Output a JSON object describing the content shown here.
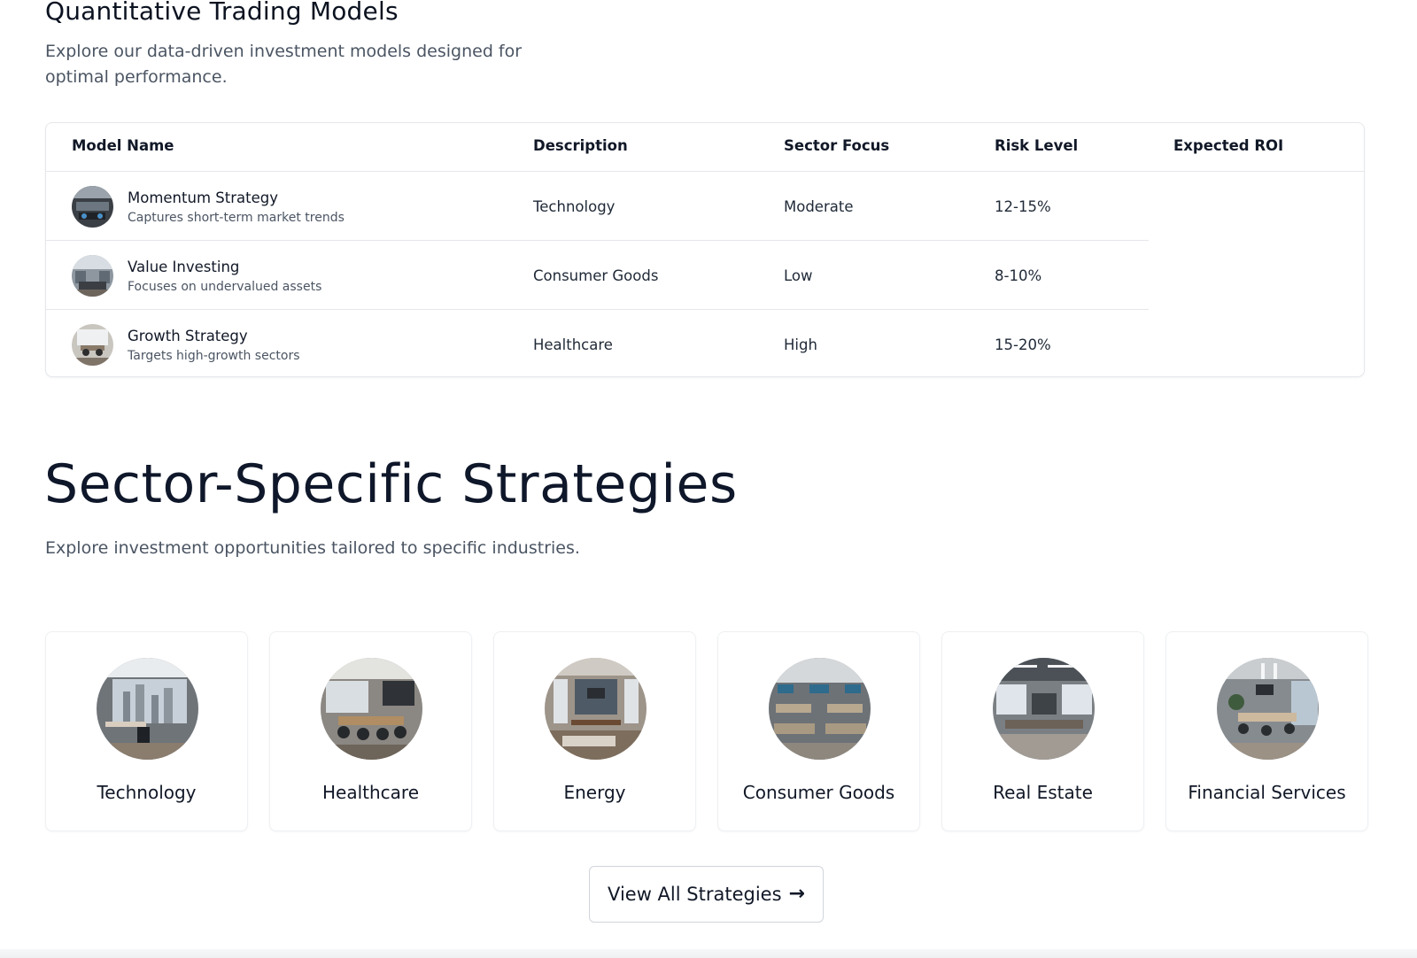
{
  "quant": {
    "title": "Quantitative Trading Models",
    "subtitle": "Explore our data-driven investment models designed for optimal performance.",
    "columns": [
      "Model Name",
      "Description",
      "Sector Focus",
      "Risk Level",
      "Expected ROI"
    ],
    "rows": [
      {
        "name": "Momentum Strategy",
        "desc": "Captures short-term market trends",
        "c1": "Technology",
        "c2": "Moderate",
        "c3": "12-15%"
      },
      {
        "name": "Value Investing",
        "desc": "Focuses on undervalued assets",
        "c1": "Consumer Goods",
        "c2": "Low",
        "c3": "8-10%"
      },
      {
        "name": "Growth Strategy",
        "desc": "Targets high-growth sectors",
        "c1": "Healthcare",
        "c2": "High",
        "c3": "15-20%"
      }
    ]
  },
  "sectors": {
    "title": "Sector-Specific Strategies",
    "subtitle": "Explore investment opportunities tailored to specific industries.",
    "items": [
      {
        "label": "Technology"
      },
      {
        "label": "Healthcare"
      },
      {
        "label": "Energy"
      },
      {
        "label": "Consumer Goods"
      },
      {
        "label": "Real Estate"
      },
      {
        "label": "Financial Services"
      }
    ],
    "cta_label": "View All Strategies",
    "cta_icon": "arrow-right-icon"
  }
}
